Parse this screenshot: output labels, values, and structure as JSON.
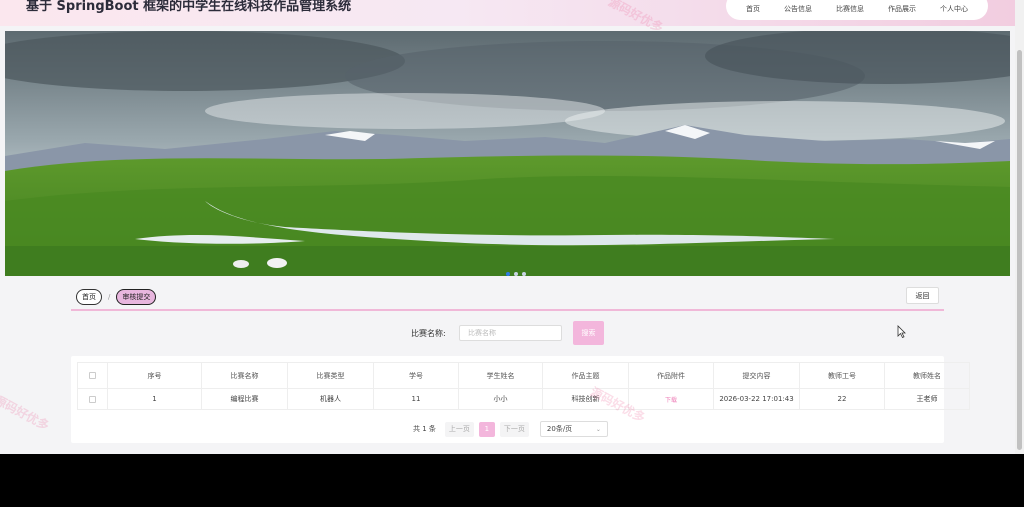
{
  "header": {
    "title": "基于 SpringBoot 框架的中学生在线科技作品管理系统",
    "nav": [
      "首页",
      "公告信息",
      "比赛信息",
      "作品展示",
      "个人中心"
    ]
  },
  "breadcrumb": {
    "home": "首页",
    "current": "审核提交",
    "separator": "/"
  },
  "back_label": "返回",
  "search": {
    "label": "比赛名称:",
    "placeholder": "比赛名称",
    "button": "搜索"
  },
  "table": {
    "headers": [
      "序号",
      "比赛名称",
      "比赛类型",
      "学号",
      "学生姓名",
      "作品主题",
      "作品附件",
      "提交内容",
      "教师工号",
      "教师姓名"
    ],
    "rows": [
      [
        "1",
        "编程比赛",
        "机器人",
        "11",
        "小小",
        "科技创新",
        "下载",
        "2026-03-22 17:01:43",
        "22",
        "王老师"
      ]
    ]
  },
  "pagination": {
    "total": "共 1 条",
    "prev": "上一页",
    "current": "1",
    "next": "下一页",
    "page_size": "20条/页"
  },
  "watermark": "源码好优多",
  "colors": {
    "accent": "#f3b6dc",
    "link": "#ee7fb8",
    "header_end": "#f2cde0"
  }
}
